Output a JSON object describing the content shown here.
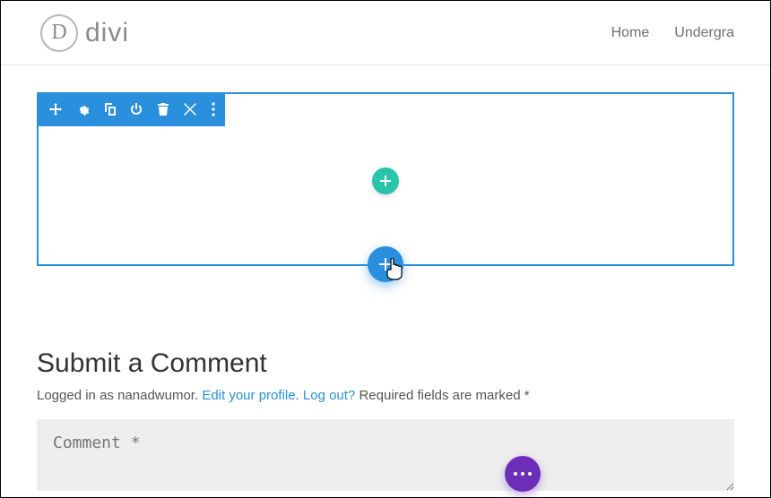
{
  "header": {
    "logo_letter": "D",
    "logo_text": "divi",
    "nav": [
      "Home",
      "Undergra"
    ]
  },
  "comments": {
    "title": "Submit a Comment",
    "logged_prefix": "Logged in as ",
    "username": "nanadwumor",
    "edit_profile": "Edit your profile",
    "logout": "Log out?",
    "required_text": "Required fields are marked *",
    "placeholder": "Comment *"
  }
}
